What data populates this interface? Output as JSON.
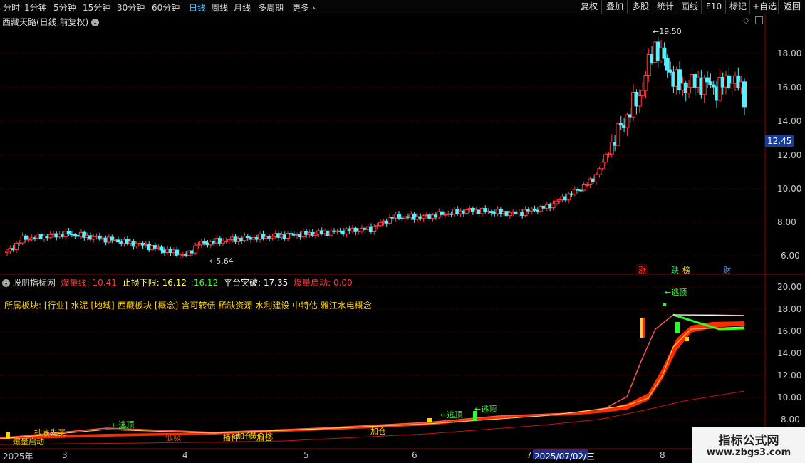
{
  "toolbar": {
    "periods": [
      "分时",
      "1分钟",
      "5分钟",
      "15分钟",
      "30分钟",
      "60分钟",
      "日线",
      "周线",
      "月线",
      "多周期",
      "更多"
    ],
    "active_period": "日线",
    "right_buttons": [
      "复权",
      "叠加",
      "多股",
      "统计",
      "画线",
      "F10",
      "标记",
      "+自选",
      "返回"
    ]
  },
  "main_panel": {
    "title": "西藏天路(日线,前复权)",
    "price_axis": [
      "18.00",
      "16.00",
      "14.00",
      "12.00",
      "10.00",
      "8.00",
      "6.00"
    ],
    "current_price": "12.45",
    "high_label": "19.50",
    "low_label": "5.64",
    "tags": [
      "涨",
      "跌",
      "榜",
      "财"
    ]
  },
  "indicator_panel": {
    "name": "股朋指标网",
    "values": [
      {
        "label": "爆量线:",
        "value": "10.41",
        "color": "#ff3b3b"
      },
      {
        "label": "止损下限:",
        "value": "16.12",
        "color": "#ffff55"
      },
      {
        "label": ":",
        "value": "16.12",
        "color": "#3cff3c"
      },
      {
        "label": "平台突破:",
        "value": "17.35",
        "color": "#ffffff"
      },
      {
        "label": "爆量启动:",
        "value": "0.00",
        "color": "#ff3b3b"
      }
    ],
    "sector_line": "所属板块: [行业]-水泥 [地域]-西藏板块 [概念]-含可转债 稀缺资源 水利建设 中特估 雅江水电概念",
    "axis": [
      "20.00",
      "18.00",
      "16.00",
      "14.00",
      "12.00",
      "10.00",
      "8.00"
    ],
    "annotations": [
      "←逃顶",
      "←逃顶",
      "←逃顶",
      "←逃顶",
      "爆量启动",
      "抄底先买",
      "加仓",
      "播种",
      "加仓",
      "黄金坑",
      "低吸",
      "加仓"
    ]
  },
  "date_axis": {
    "labels": [
      "2025年",
      "3",
      "4",
      "5",
      "6",
      "7",
      "8"
    ],
    "cursor_date": "2025/07/02/三"
  },
  "watermark": {
    "title": "指标公式网",
    "url": "www.zbgs3.com"
  },
  "colors": {
    "up": "#ff3b3b",
    "down": "#54f0ff",
    "grid": "#7a0000",
    "active_tab": "#4fc3ff"
  }
}
